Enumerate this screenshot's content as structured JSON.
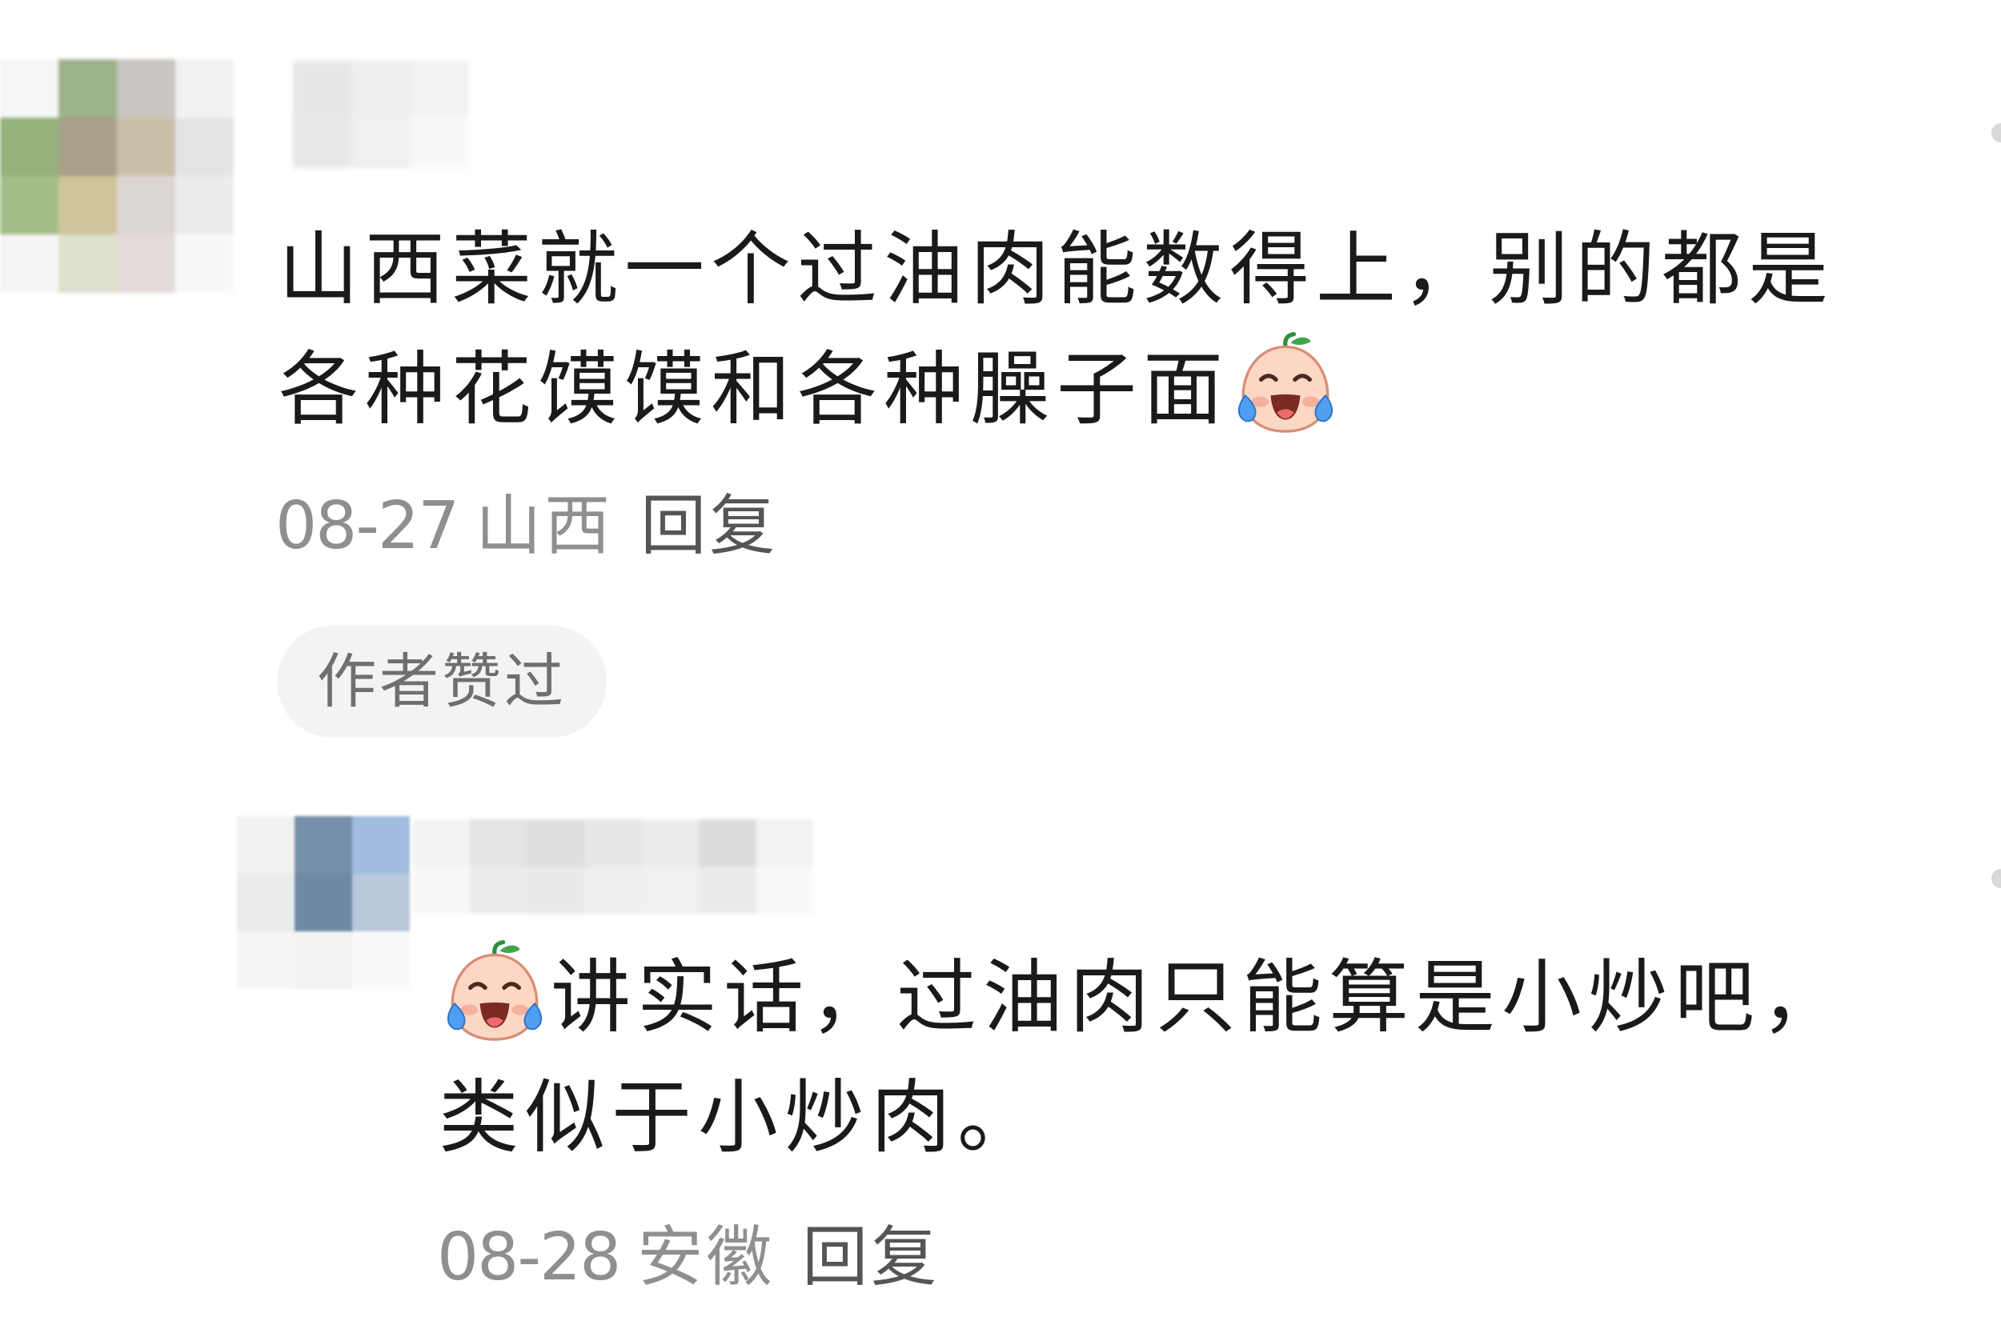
{
  "comments": [
    {
      "text_before_emoji": "山西菜就一个过油肉能数得上，别的都是各种花馍馍和各种臊子面",
      "emoji": "laughing-crying-peach-icon",
      "date": "08-27",
      "region": "山西",
      "reply_label": "回复",
      "author_liked_label": "作者赞过"
    },
    {
      "emoji": "laughing-crying-peach-icon",
      "text_after_emoji": "讲实话，过油肉只能算是小炒吧，类似于小炒肉。",
      "date": "08-28",
      "region": "安徽",
      "reply_label": "回复"
    }
  ],
  "colors": {
    "background": "#ffffff",
    "text": "#1a1a1a",
    "meta": "#8f8f8f",
    "reply": "#555555",
    "pill_background": "#f3f3f3",
    "pill_text": "#6f6f6f"
  },
  "mosaics": {
    "avatar_1": [
      "#f6f6f6",
      "#9db38a",
      "#c9c6c1",
      "#f1f1f1",
      "#95b37a",
      "#a8a088",
      "#c9bfa6",
      "#e4e4e4",
      "#a2bd86",
      "#cfc59a",
      "#dcd6d3",
      "#ececec",
      "#f5f5f5",
      "#dfe0cf",
      "#e2dbd9",
      "#f8f8f8"
    ],
    "username_1": [
      "#e7e7e7",
      "#eeeeee",
      "#f2f2f2",
      "#e8e8e8",
      "#f0f0f0",
      "#f7f7f7"
    ],
    "avatar_2": [
      "#f1f1f1",
      "#7590a8",
      "#a2bce0",
      "#ebeded",
      "#6f8ba3",
      "#b9c9dc",
      "#f5f5f5",
      "#f3f3f3",
      "#fafafa"
    ],
    "username_2": [
      "#f3f3f3",
      "#e4e4e4",
      "#dedede",
      "#e6e6e6",
      "#ececec",
      "#dcdcdc",
      "#f2f2f2",
      "#f7f7f7",
      "#ececec",
      "#e9e9e9",
      "#eeeeee",
      "#f0f0f0",
      "#ebebeb",
      "#f9f9f9"
    ]
  }
}
